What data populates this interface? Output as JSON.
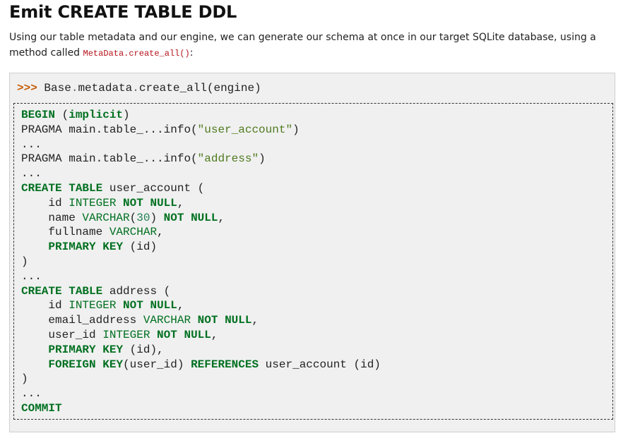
{
  "heading": "Emit CREATE TABLE DDL",
  "intro": {
    "text": "Using our table metadata and our engine, we can generate our schema at once in our target SQLite database, using a method called ",
    "code": "MetaData.create_all()",
    "suffix": ":"
  },
  "code_block": {
    "prompt": ">>>",
    "statement": {
      "object": "Base",
      "attr1": "metadata",
      "method": "create_all",
      "arg": "(engine)"
    },
    "output_lines": [
      "BEGIN (implicit)",
      "PRAGMA main.table_...info(\"user_account\")",
      "...",
      "PRAGMA main.table_...info(\"address\")",
      "...",
      "CREATE TABLE user_account (",
      "    id INTEGER NOT NULL,",
      "    name VARCHAR(30) NOT NULL,",
      "    fullname VARCHAR,",
      "    PRIMARY KEY (id)",
      ")",
      "...",
      "CREATE TABLE address (",
      "    id INTEGER NOT NULL,",
      "    email_address VARCHAR NOT NULL,",
      "    user_id INTEGER NOT NULL,",
      "    PRIMARY KEY (id),",
      "    FOREIGN KEY(user_id) REFERENCES user_account (id)",
      ")",
      "...",
      "COMMIT"
    ]
  },
  "colors": {
    "keyword": "#007020",
    "string": "#4e7a1e",
    "number": "#208050",
    "prompt": "#c65d09",
    "inline_code": "#b5121b",
    "block_background": "#f0f0f0"
  }
}
